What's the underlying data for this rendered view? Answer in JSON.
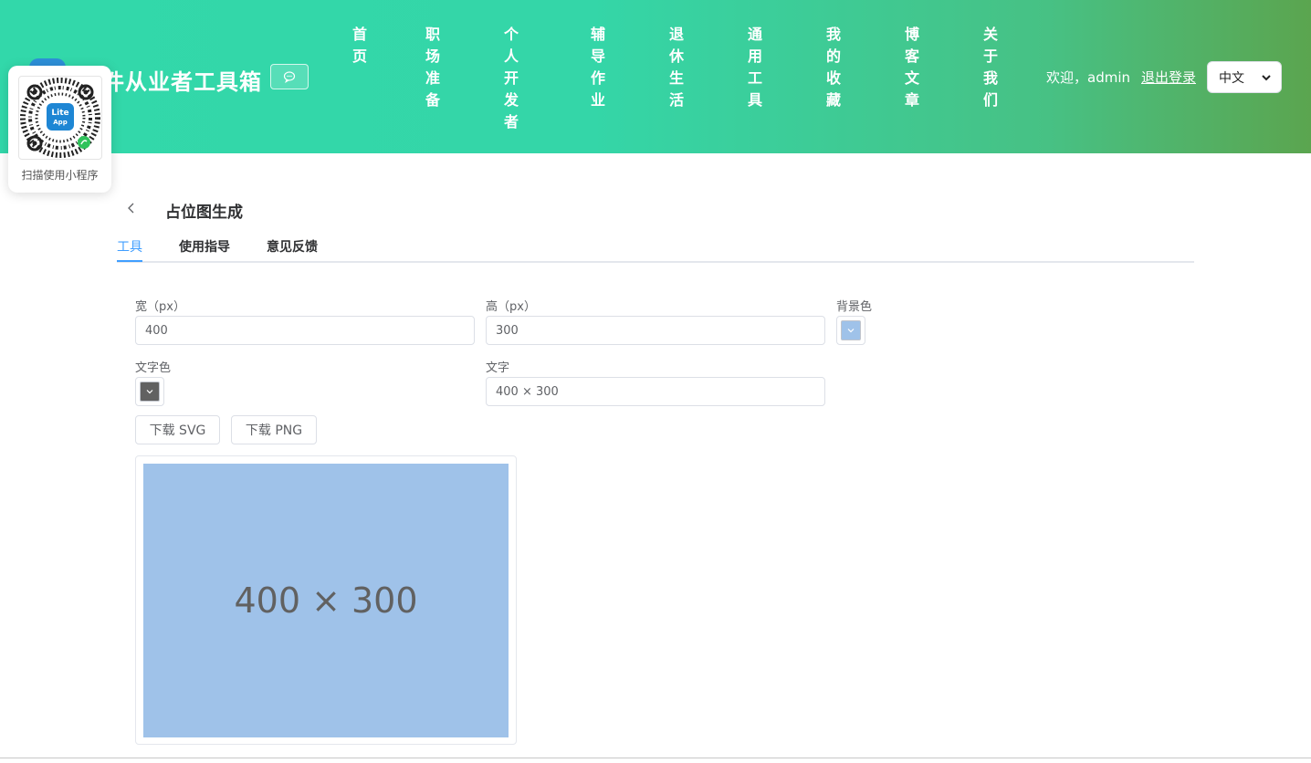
{
  "header": {
    "site_title": "件从业者工具箱",
    "nav": [
      {
        "label": "首页"
      },
      {
        "label": "职场准备"
      },
      {
        "label": "个人开发者"
      },
      {
        "label": "辅导作业"
      },
      {
        "label": "退休生活"
      },
      {
        "label": "通用工具"
      },
      {
        "label": "我的收藏"
      },
      {
        "label": "博客文章"
      },
      {
        "label": "关于我们"
      }
    ],
    "welcome": "欢迎，admin",
    "logout": "退出登录",
    "language": "中文"
  },
  "mini_program": {
    "caption": "扫描使用小程序",
    "badge_line1": "Lite",
    "badge_line2": "App"
  },
  "page": {
    "title": "占位图生成",
    "tabs": [
      {
        "label": "工具",
        "active": true
      },
      {
        "label": "使用指导",
        "active": false
      },
      {
        "label": "意见反馈",
        "active": false
      }
    ]
  },
  "form": {
    "width_label": "宽（px）",
    "width_value": "400",
    "height_label": "高（px）",
    "height_value": "300",
    "bg_color_label": "背景色",
    "bg_color": "#9fc2e9",
    "text_color_label": "文字色",
    "text_color": "#616161",
    "text_label": "文字",
    "text_value": "400 × 300",
    "download_svg": "下载 SVG",
    "download_png": "下载 PNG"
  },
  "preview": {
    "text": "400 × 300"
  },
  "colors": {
    "accent": "#409eff",
    "header_gradient_start": "#32d8aa",
    "header_gradient_end": "#5ba54f"
  }
}
